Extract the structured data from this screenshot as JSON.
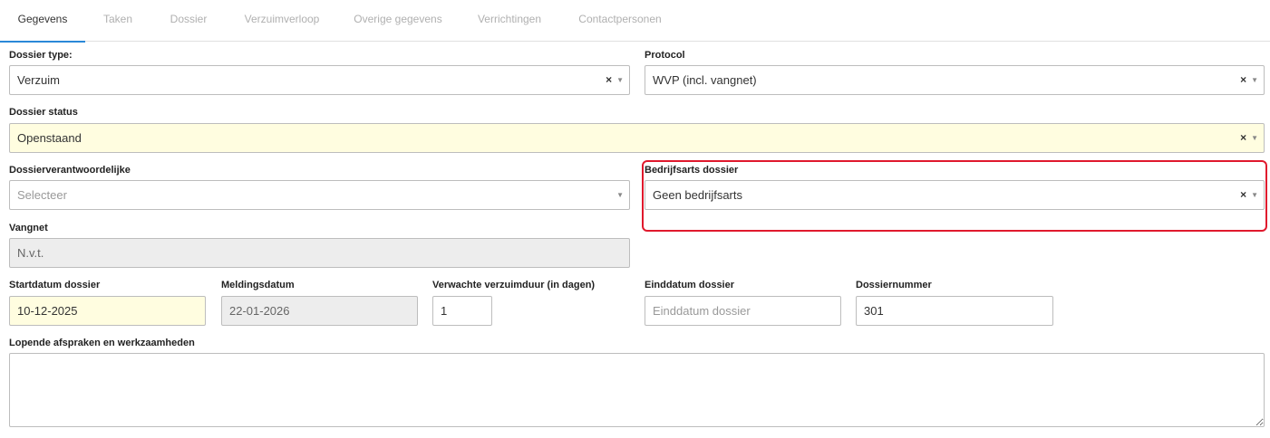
{
  "tabs": [
    {
      "label": "Gegevens"
    },
    {
      "label": "Taken"
    },
    {
      "label": "Dossier"
    },
    {
      "label": "Verzuimverloop"
    },
    {
      "label": "Overige gegevens"
    },
    {
      "label": "Verrichtingen"
    },
    {
      "label": "Contactpersonen"
    }
  ],
  "active_tab": "Gegevens",
  "accent_color": "#2a88d8",
  "highlight_color": "#e0192d",
  "form": {
    "dossier_type": {
      "label": "Dossier type:",
      "value": "Verzuim"
    },
    "protocol": {
      "label": "Protocol",
      "value": "WVP (incl. vangnet)"
    },
    "dossier_status": {
      "label": "Dossier status",
      "value": "Openstaand"
    },
    "dossierverantwoordelijke": {
      "label": "Dossierverantwoordelijke",
      "placeholder": "Selecteer"
    },
    "bedrijfsarts": {
      "label": "Bedrijfsarts dossier",
      "value": "Geen bedrijfsarts"
    },
    "vangnet": {
      "label": "Vangnet",
      "value": "N.v.t."
    },
    "startdatum": {
      "label": "Startdatum dossier",
      "value": "10-12-2025"
    },
    "meldingsdatum": {
      "label": "Meldingsdatum",
      "value": "22-01-2026"
    },
    "verwachte_duur": {
      "label": "Verwachte verzuimduur (in dagen)",
      "value": "1"
    },
    "einddatum": {
      "label": "Einddatum dossier",
      "placeholder": "Einddatum dossier"
    },
    "dossiernummer": {
      "label": "Dossiernummer",
      "value": "301"
    },
    "afspraken": {
      "label": "Lopende afspraken en werkzaamheden",
      "value": ""
    }
  },
  "icons": {
    "clear": "clear-x-icon",
    "dropdown": "caret-down-icon"
  }
}
